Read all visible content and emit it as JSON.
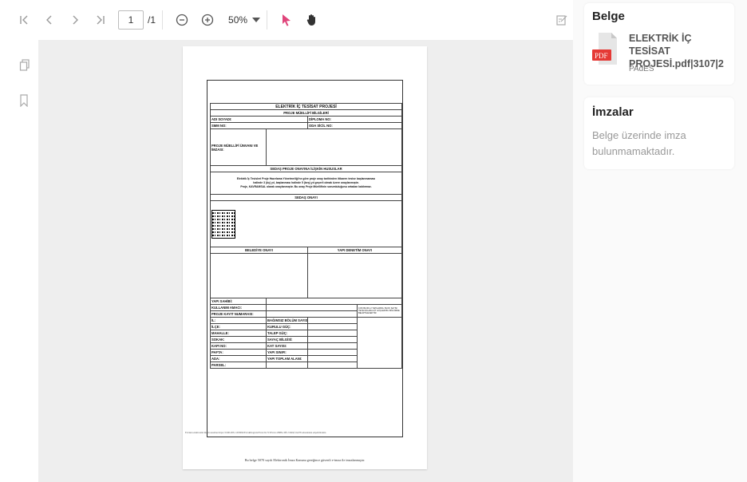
{
  "toolbar": {
    "page_current": "1",
    "page_total": "/1",
    "zoom": "50%"
  },
  "document": {
    "title": "ELEKTRİK İÇ TESİSAT PROJESİ",
    "sections": {
      "muellif": "PROJE MÜELLİFİ BİLGİLERİ",
      "adi_soyadi": "ADI SOYADI:",
      "diploma_no": "DİPLOMA NO:",
      "smm_no": "SMM NO:",
      "oda_sicil": "ODA SİCİL NO:",
      "unvan": "PROJE MÜELLİFİ ÜNVANI VE İMZASI:",
      "sedas_hususlar": "SEDAŞ PROJE ONAYINA İLİŞKİN HUSUSLAR",
      "sedas_text_1": "Elektrik İç Tesisleri Proje Hazırlama Yönetmeliği'ne göre proje onay tarihinden itibaren tesise başlanmaması",
      "sedas_text_2": "halinde 3 (üç) yıl, başlanması halinde 5 (beş) yıl geçerli olmak üzere onaylanmıştır.",
      "sedas_text_3": "Proje, KAVRAMSAL olarak onaylanmıştır. Bu onay Proje Müellifinin sorumluluğunu ortadan kaldırmaz.",
      "sedas_onayi": "SEDAŞ ONAYI",
      "belediye_onayi": "BELEDİYE ONAYI",
      "yapi_denetim_onayi": "YAPI DENETİM ONAYI",
      "yapi_sahibi": "YAPI SAHİBİ:",
      "kullanim_amaci": "KULLANIM AMACI:",
      "proje_kayit": "PROJE KAYIT NUMARASI:",
      "note": "ÇOK BLOKLU YAPILARDA, BLOK SAYISI VE BLOKLARA AİT GÜÇLER BU BÖLÜMDE BELİRTİLECEKTİR.",
      "il": "İL:",
      "ilce": "İLÇE:",
      "mahalle": "MAHALLE:",
      "sokak": "SOKAK:",
      "kapi_no": "KAPI NO:",
      "pafta": "PAFTA:",
      "ada": "ADA:",
      "parsel": "PARSEL:",
      "bagimsiz": "BAĞIMSIZ BÖLÜM SAYISI:",
      "kurulu_guc": "KURULU GÜÇ:",
      "talep_guc": "TALEP GÜÇ:",
      "sayac": "SAYAÇ BİLGİSİ:",
      "kat_sayisi": "KAT SAYISI:",
      "yapi_sinifi": "YAPI SINIFI:",
      "toplam_alan": "YAPI TOPLAM ALANI:"
    },
    "verify_line": "Evrakın elektronik imzalı suretine https://0190.285.110:8092/EvrakDogrula/Eval-Ns/?15Evn1c-8888-c0f0-74b0af-0ad78 adresinden erişebilirsiniz.",
    "footer": "Bu belge 5070 sayılı Elektronik İmza Kanunu gereğince güvenli e-imza ile imzalanmıştır."
  },
  "side": {
    "belge_title": "Belge",
    "pdf_badge": "PDF",
    "file_name": "ELEKTRİK İÇ TESİSAT PROJESİ.pdf|3107|2",
    "file_type": "PAdES",
    "imzalar_title": "İmzalar",
    "imzalar_msg": "Belge üzerinde imza bulunmamaktadır."
  }
}
